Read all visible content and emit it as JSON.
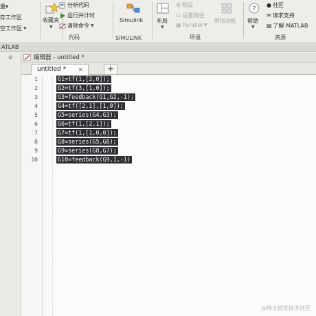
{
  "ribbon": {
    "variable_label": "量▾",
    "save_workspace": "存工作区",
    "clear_workspace": "空工作区",
    "favorites": "收藏夹",
    "analyze_code": "分析代码",
    "run_and_time": "运行并计时",
    "clear_commands": "清除命令",
    "code_section": "代码",
    "simulink_button": "Simulink",
    "simulink_section": "SIMULINK",
    "layout": "布局",
    "preferences": "预设",
    "set_path": "设置路径",
    "parallel": "Parallel",
    "addons": "附加功能",
    "environment_section": "环境",
    "help": "帮助",
    "community": "社区",
    "request_support": "请求支持",
    "learn_matlab": "了解 MATLAB",
    "resources_section": "资源"
  },
  "strip": {
    "label": "ATLAB"
  },
  "editor": {
    "title": "编辑器 - untitled *",
    "tab_label": "untitled *",
    "tab_close": "✕",
    "tab_add": "+"
  },
  "code": {
    "line_numbers": [
      "1",
      "2",
      "3",
      "4",
      "5",
      "6",
      "7",
      "8",
      "9",
      "10"
    ],
    "lines": [
      "G1=tf(1,[2,0]);",
      "G2=tf(3,[1,0]);",
      "G3=feedback(G1,G2,-1);",
      "G4=tf([2,1],[1,0]);",
      "G5=series(G4,G3);",
      "G6=tf(1,[2,1]);",
      "G7=tf(1,[1,0,0]);",
      "G8=series(G5,G6);",
      "G9=series(G8,G7);",
      "G10=feedback(G9,1,-1)"
    ]
  },
  "watermark": "@稀土掘金技术社区",
  "colors": {
    "selection": "#2e2f33",
    "ribbon_bg": "#eeedea",
    "code_bg": "#fbfbfa"
  }
}
